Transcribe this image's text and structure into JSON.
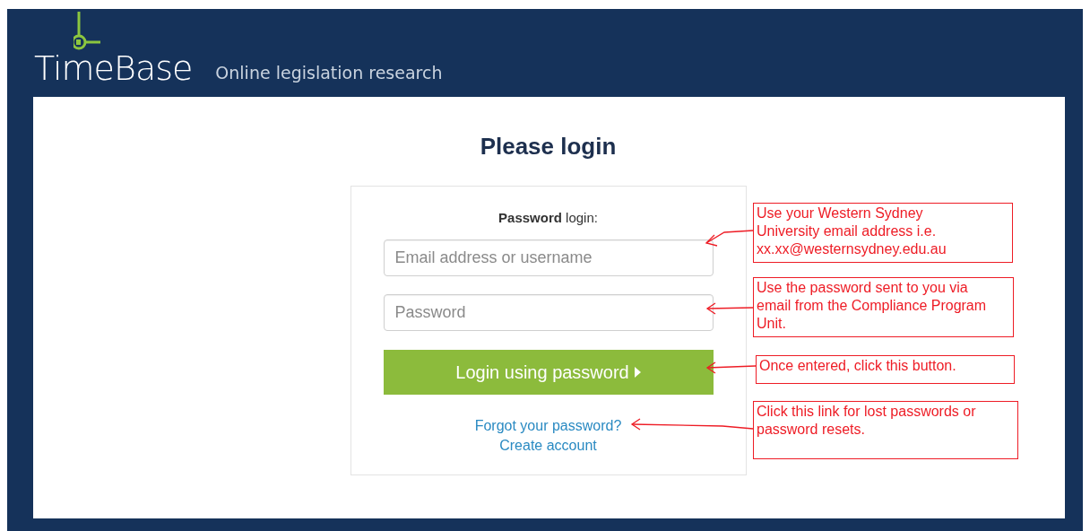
{
  "header": {
    "logo_text": "TimeBase",
    "tagline": "Online legislation research"
  },
  "title": "Please login",
  "card": {
    "heading": "**Password** login:",
    "fields": [
      {
        "placeholder": "Email address or username"
      },
      {
        "placeholder": "Password"
      }
    ],
    "button": {
      "label": "Login using password"
    },
    "links": [
      "Forgot your password?",
      "Create account"
    ]
  },
  "annotations": [
    {
      "text": "Use your Western Sydney University email address i.e. xx.xx@westernsydney.edu.au"
    },
    {
      "text": "Use the password sent to you via email from the Compliance Program Unit."
    },
    {
      "text": "Once entered, click this button."
    },
    {
      "text": "Click this link for lost passwords or password resets."
    }
  ]
}
